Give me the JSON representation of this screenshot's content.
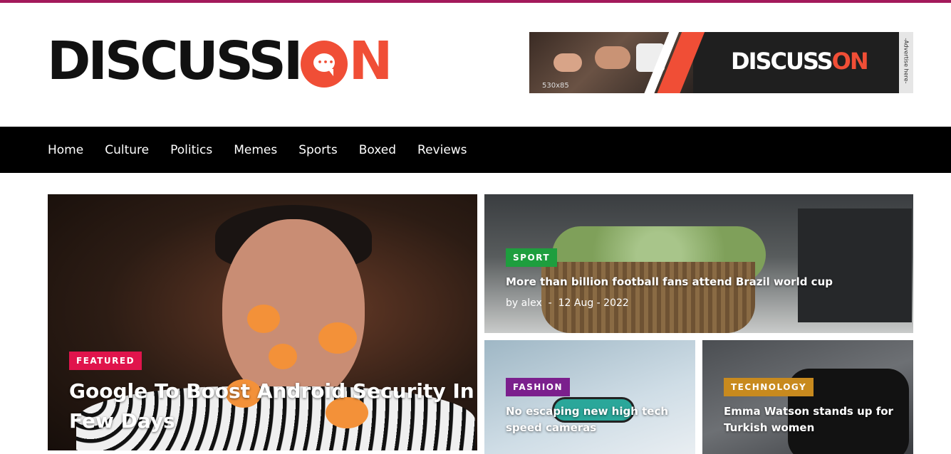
{
  "logo": {
    "text_start": "DISCUSSI",
    "text_end": "N"
  },
  "ad": {
    "size_label": "530x85",
    "brand_start": "DISCUSS",
    "brand_end": "N",
    "side_label": "-Advertise here-"
  },
  "nav": {
    "items": [
      "Home",
      "Culture",
      "Politics",
      "Memes",
      "Sports",
      "Boxed",
      "Reviews"
    ]
  },
  "posts": [
    {
      "category": "FEATURED",
      "category_color": "#e0144c",
      "title": "Google To Boost Android Security In Few Days"
    },
    {
      "category": "SPORT",
      "category_color": "#1e9e3e",
      "title": "More than billion football fans attend Brazil world cup",
      "author": "by alex",
      "date": "12 Aug - 2022"
    },
    {
      "category": "FASHION",
      "category_color": "#7b1f8d",
      "title": "No escaping new high tech speed cameras"
    },
    {
      "category": "TECHNOLOGY",
      "category_color": "#c88a1e",
      "title": "Emma Watson stands up for Turkish women"
    }
  ],
  "colors": {
    "accent": "#f04e36",
    "topline": "#a3195b"
  }
}
